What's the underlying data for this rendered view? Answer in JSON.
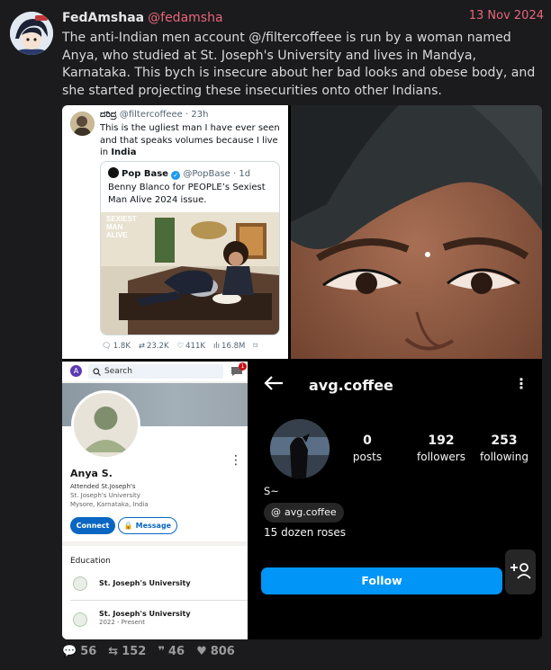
{
  "post": {
    "display_name": "FedAmshaa",
    "handle": "@fedamsha",
    "date": "13 Nov 2024",
    "text": "The anti-Indian men account @/filtercoffeee is run by a woman named Anya, who studied at St. Joseph's University and lives in Mandya, Karnataka. This bych is insecure about her bad looks and obese body, and she started projecting these insecurities onto other Indians.",
    "stats": {
      "replies": "56",
      "reposts": "152",
      "quotes": "46",
      "likes": "806"
    }
  },
  "tweet": {
    "name": "ದರಿದ್ರ",
    "handle": "@filtercoffeee",
    "time": "· 23h",
    "text_pre": "This is the ugliest man I have ever seen and that speaks volumes because I live in",
    "text_bold": "India",
    "quote": {
      "name": "Pop Base",
      "handle": "@PopBase · 1d",
      "text": "Benny Blanco for PEOPLE’s Sexiest Man Alive 2024 issue.",
      "magazine_lines": [
        "SEXIEST",
        "MAN",
        "ALIVE"
      ]
    },
    "metrics": {
      "replies": "1.8K",
      "reposts": "23.2K",
      "likes": "411K",
      "views": "16.8M"
    }
  },
  "linkedin": {
    "me_initial": "A",
    "search_placeholder": "Search",
    "notif_count": "1",
    "name": "Anya S.",
    "headline": "Attended St.Joseph's",
    "school_line": "St. Joseph's University",
    "location": "Mysore, Karnataka, India",
    "connect": "Connect",
    "message": "Message",
    "education_title": "Education",
    "education": [
      {
        "school": "St. Joseph's University",
        "years": ""
      },
      {
        "school": "St. Joseph's University",
        "years": "2022 - Present"
      }
    ]
  },
  "instagram": {
    "username": "avg.coffee",
    "posts": "0",
    "posts_label": "posts",
    "followers": "192",
    "followers_label": "followers",
    "following": "253",
    "following_label": "following",
    "name": "S~",
    "threads": "avg.coffee",
    "bio": "15 dozen roses",
    "follow": "Follow"
  },
  "colors": {
    "accent": "#e8657a",
    "linkedin_blue": "#0a66c2",
    "instagram_blue": "#0095f6"
  }
}
